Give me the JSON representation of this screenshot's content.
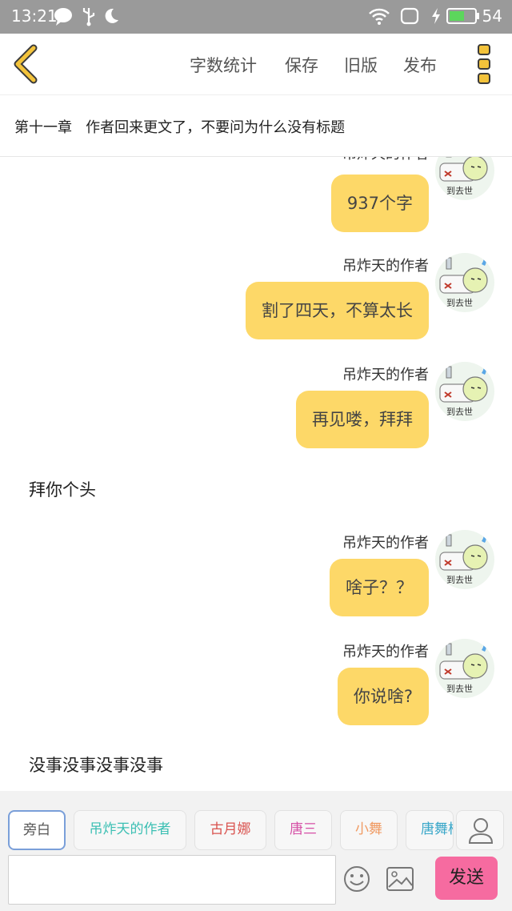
{
  "status_bar": {
    "time": "13:21",
    "battery": "54",
    "icons": [
      "chat-bubble-icon",
      "usb-icon",
      "moon-icon",
      "wifi-icon",
      "rounded-square-icon",
      "flash-icon",
      "battery-icon"
    ]
  },
  "toolbar": {
    "back_icon": "chevron-left-icon",
    "actions": {
      "word_count": "字数统计",
      "save": "保存",
      "old_version": "旧版",
      "publish": "发布"
    },
    "more_icon": "vertical-dots-menu-icon",
    "accent_color": "#f3c33b"
  },
  "chapter": {
    "title": "第十一章   作者回来更文了，不要问为什么没有标题"
  },
  "chat": {
    "bubble_color": "#fdd868",
    "messages": [
      {
        "type": "character",
        "sender": "吊炸天的作者",
        "text": "937个字"
      },
      {
        "type": "character",
        "sender": "吊炸天的作者",
        "text": "割了四天，不算太长"
      },
      {
        "type": "character",
        "sender": "吊炸天的作者",
        "text": "再见喽，拜拜"
      },
      {
        "type": "narration",
        "text": "拜你个头"
      },
      {
        "type": "character",
        "sender": "吊炸天的作者",
        "text": "啥子？？"
      },
      {
        "type": "character",
        "sender": "吊炸天的作者",
        "text": "你说啥?"
      },
      {
        "type": "narration",
        "text": "没事没事没事没事"
      }
    ],
    "avatar_caption": "到去世"
  },
  "characters": {
    "items": [
      {
        "label": "旁白",
        "color": "#555555",
        "selected": true
      },
      {
        "label": "吊炸天的作者",
        "color": "#3bbfb3",
        "selected": false
      },
      {
        "label": "古月娜",
        "color": "#d9534f",
        "selected": false
      },
      {
        "label": "唐三",
        "color": "#d64fa6",
        "selected": false
      },
      {
        "label": "小舞",
        "color": "#f09a62",
        "selected": false
      },
      {
        "label": "唐舞桐",
        "color": "#3aa7c9",
        "selected": false
      }
    ],
    "user_icon": "person-icon"
  },
  "input": {
    "placeholder": "",
    "emoji_icon": "smiley-icon",
    "image_icon": "image-icon",
    "send_label": "发送",
    "send_color": "#f66ba0"
  }
}
